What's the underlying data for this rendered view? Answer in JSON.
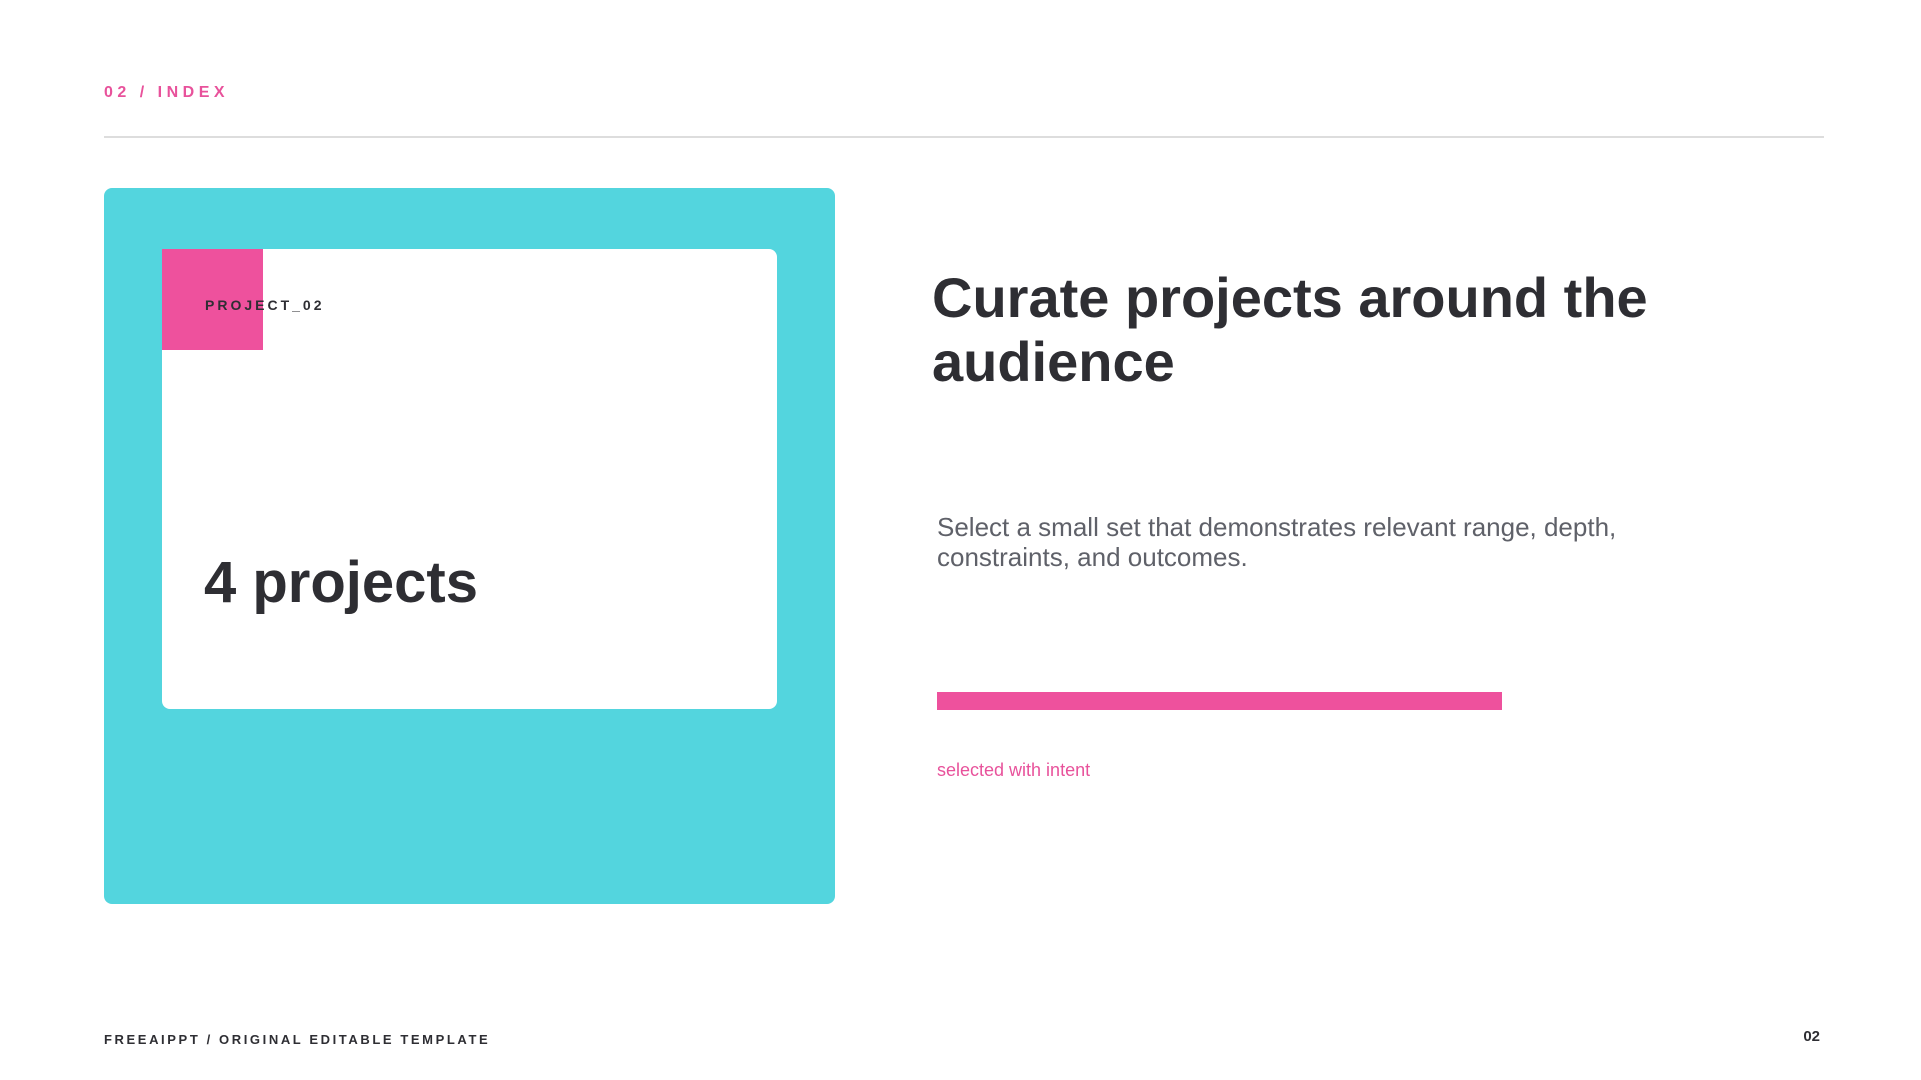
{
  "header": {
    "section_label": "02 / INDEX"
  },
  "card": {
    "tag": "PROJECT_02",
    "metric": "4 projects"
  },
  "content": {
    "headline": "Curate projects around the audience",
    "body": "Select a small set that demonstrates relevant range, depth, constraints, and outcomes.",
    "accent_caption": "selected with intent"
  },
  "footer": {
    "credit": "FREEAIPPT / ORIGINAL EDITABLE TEMPLATE",
    "page_number": "02"
  },
  "colors": {
    "accent_pink": "#ee519d",
    "panel_cyan": "#53d5de",
    "text_dark": "#2e2e33",
    "text_muted": "#5f6169",
    "rule_gray": "#dddddd"
  }
}
